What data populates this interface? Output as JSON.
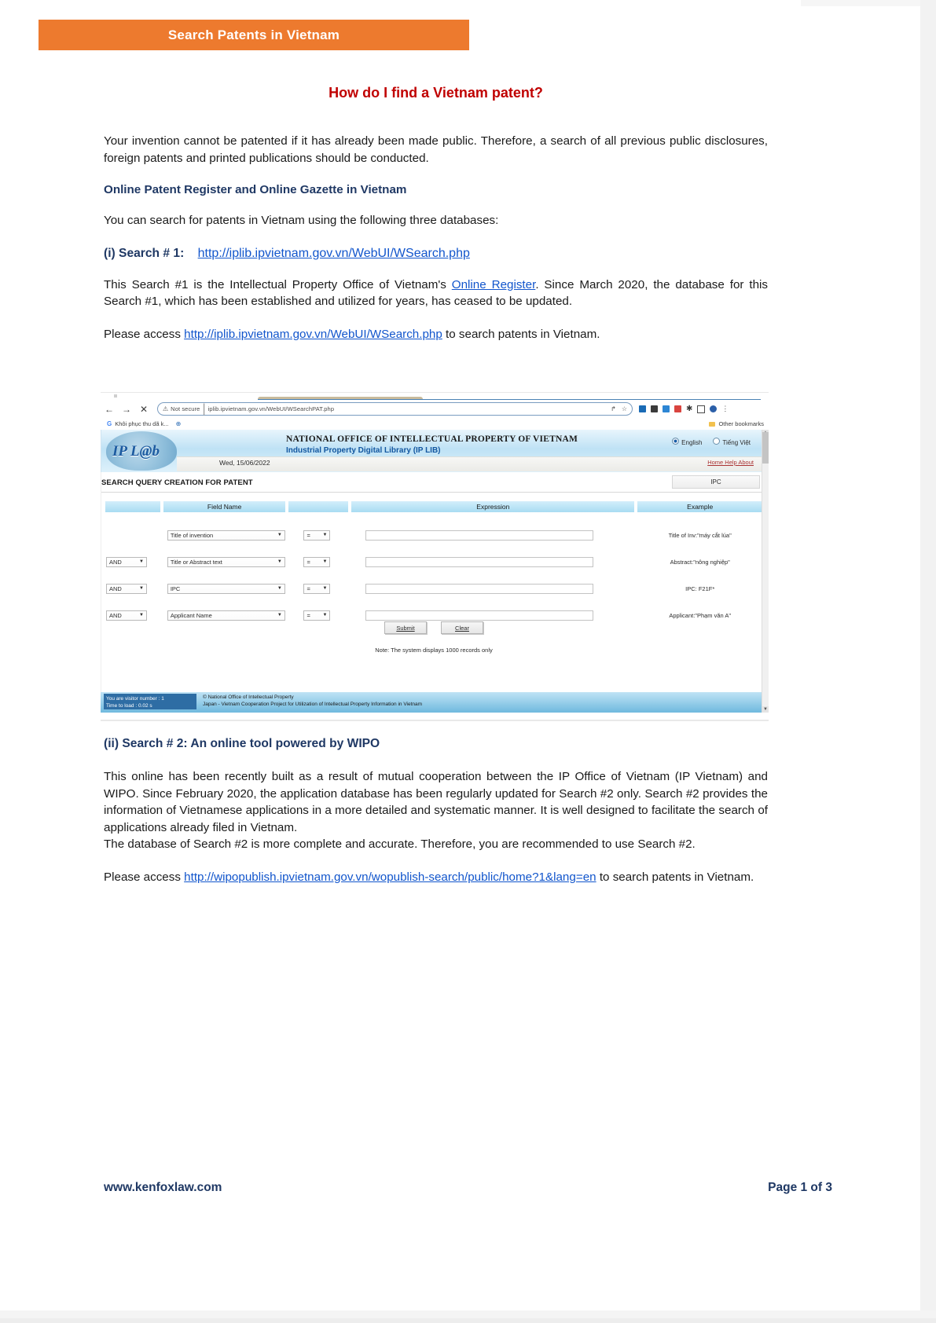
{
  "banner": {
    "title": "Search Patents in Vietnam"
  },
  "document": {
    "title": "How do I find a Vietnam patent?",
    "intro": "Your invention cannot be patented if it has already been made public. Therefore, a search of all previous public disclosures, foreign patents and printed publications should be conducted.",
    "subhead": "Online Patent Register and Online Gazette in Vietnam",
    "databases_line": "You can search for patents in Vietnam using the following three databases:",
    "search1": {
      "label": "(i) Search # 1:",
      "url": "http://iplib.ipvietnam.gov.vn/WebUI/WSearch.php",
      "para_before_link": "This Search #1 is the Intellectual Property Office of Vietnam's ",
      "register_link": "Online Register",
      "para_after_link": ". Since March 2020, the database for this Search #1, which has been established and utilized for years, has ceased to be updated.",
      "access_prefix": "Please access ",
      "access_url": "http://iplib.ipvietnam.gov.vn/WebUI/WSearch.php",
      "access_suffix": " to search patents in Vietnam."
    },
    "search2": {
      "label": "(ii) Search # 2:  An online tool powered by WIPO",
      "para1": "This online has been recently built as a result of mutual cooperation between the IP Office of Vietnam (IP Vietnam) and WIPO. Since February 2020, the application database has been regularly updated for Search #2 only.  Search #2 provides the information of Vietnamese applications in a more detailed and systematic manner. It is well designed to facilitate the search of applications already filed in Vietnam.",
      "para2": "The database of Search #2 is  more  complete  and  accurate.  Therefore,  you  are  recommended  to use Search #2.",
      "access_prefix": "Please    access    ",
      "access_url": "http://wipopublish.ipvietnam.gov.vn/wopublish-search/public/home?1&lang=en",
      "access_suffix": "    to search patents in Vietnam."
    }
  },
  "screenshot": {
    "browser": {
      "back_icon": "←",
      "forward_icon": "→",
      "stop_icon": "✕",
      "security_icon": "⚠",
      "security_label": "Not secure",
      "url": "iplib.ipvietnam.gov.vn/WebUI/WSearchPAT.php",
      "share_icon": "↱",
      "bookmark_icon": "☆",
      "menu_icon": "⋮",
      "bookmarks": {
        "g_icon": "G",
        "first_label": "Khôi phục thu dã k...",
        "globe_icon": "⊕",
        "other_label": "Other bookmarks"
      }
    },
    "site": {
      "logo_text": "IP L@b",
      "office_name": "NATIONAL OFFICE OF INTELLECTUAL PROPERTY OF VIETNAM",
      "library_name": "Industrial Property Digital Library (IP LIB)",
      "lang_en": "English",
      "lang_vi": "Tiếng Việt",
      "date": "Wed, 15/06/2022",
      "nav_links": "Home Help About",
      "section_title": "SEARCH QUERY CREATION FOR PATENT",
      "ipc_button": "IPC",
      "table_headers": [
        "",
        "Field Name",
        "",
        "Expression",
        "Example"
      ],
      "rows": [
        {
          "operator": "",
          "field": "Title of invention",
          "comparator": "=",
          "expression": "",
          "example": "Title of Inv:\"máy cắt lúa\""
        },
        {
          "operator": "AND",
          "field": "Title or Abstract text",
          "comparator": "=",
          "expression": "",
          "example": "Abstract:\"nông nghiệp\""
        },
        {
          "operator": "AND",
          "field": "IPC",
          "comparator": "=",
          "expression": "",
          "example": "IPC: F21F*"
        },
        {
          "operator": "AND",
          "field": "Applicant Name",
          "comparator": "=",
          "expression": "",
          "example": "Applicant:\"Phạm văn A\""
        }
      ],
      "submit_label": "Submit",
      "clear_label": "Clear",
      "note": "Note: The system displays 1000 records only",
      "visitor_line1": "You are visitor number : 1",
      "visitor_line2": "Time to load : 0.02 s",
      "copyright_line1": "© National Office of Intellectual Property",
      "copyright_line2": "Japan - Vietnam Cooperation Project for Utilization of Intellectual Property Information in Vietnam"
    }
  },
  "footer": {
    "website": "www.kenfoxlaw.com",
    "page_number": "Page 1 of 3"
  },
  "colors": {
    "banner_orange": "#ed7a2e",
    "title_red": "#c00000",
    "heading_navy": "#1f3864",
    "link_blue": "#1155cc"
  }
}
